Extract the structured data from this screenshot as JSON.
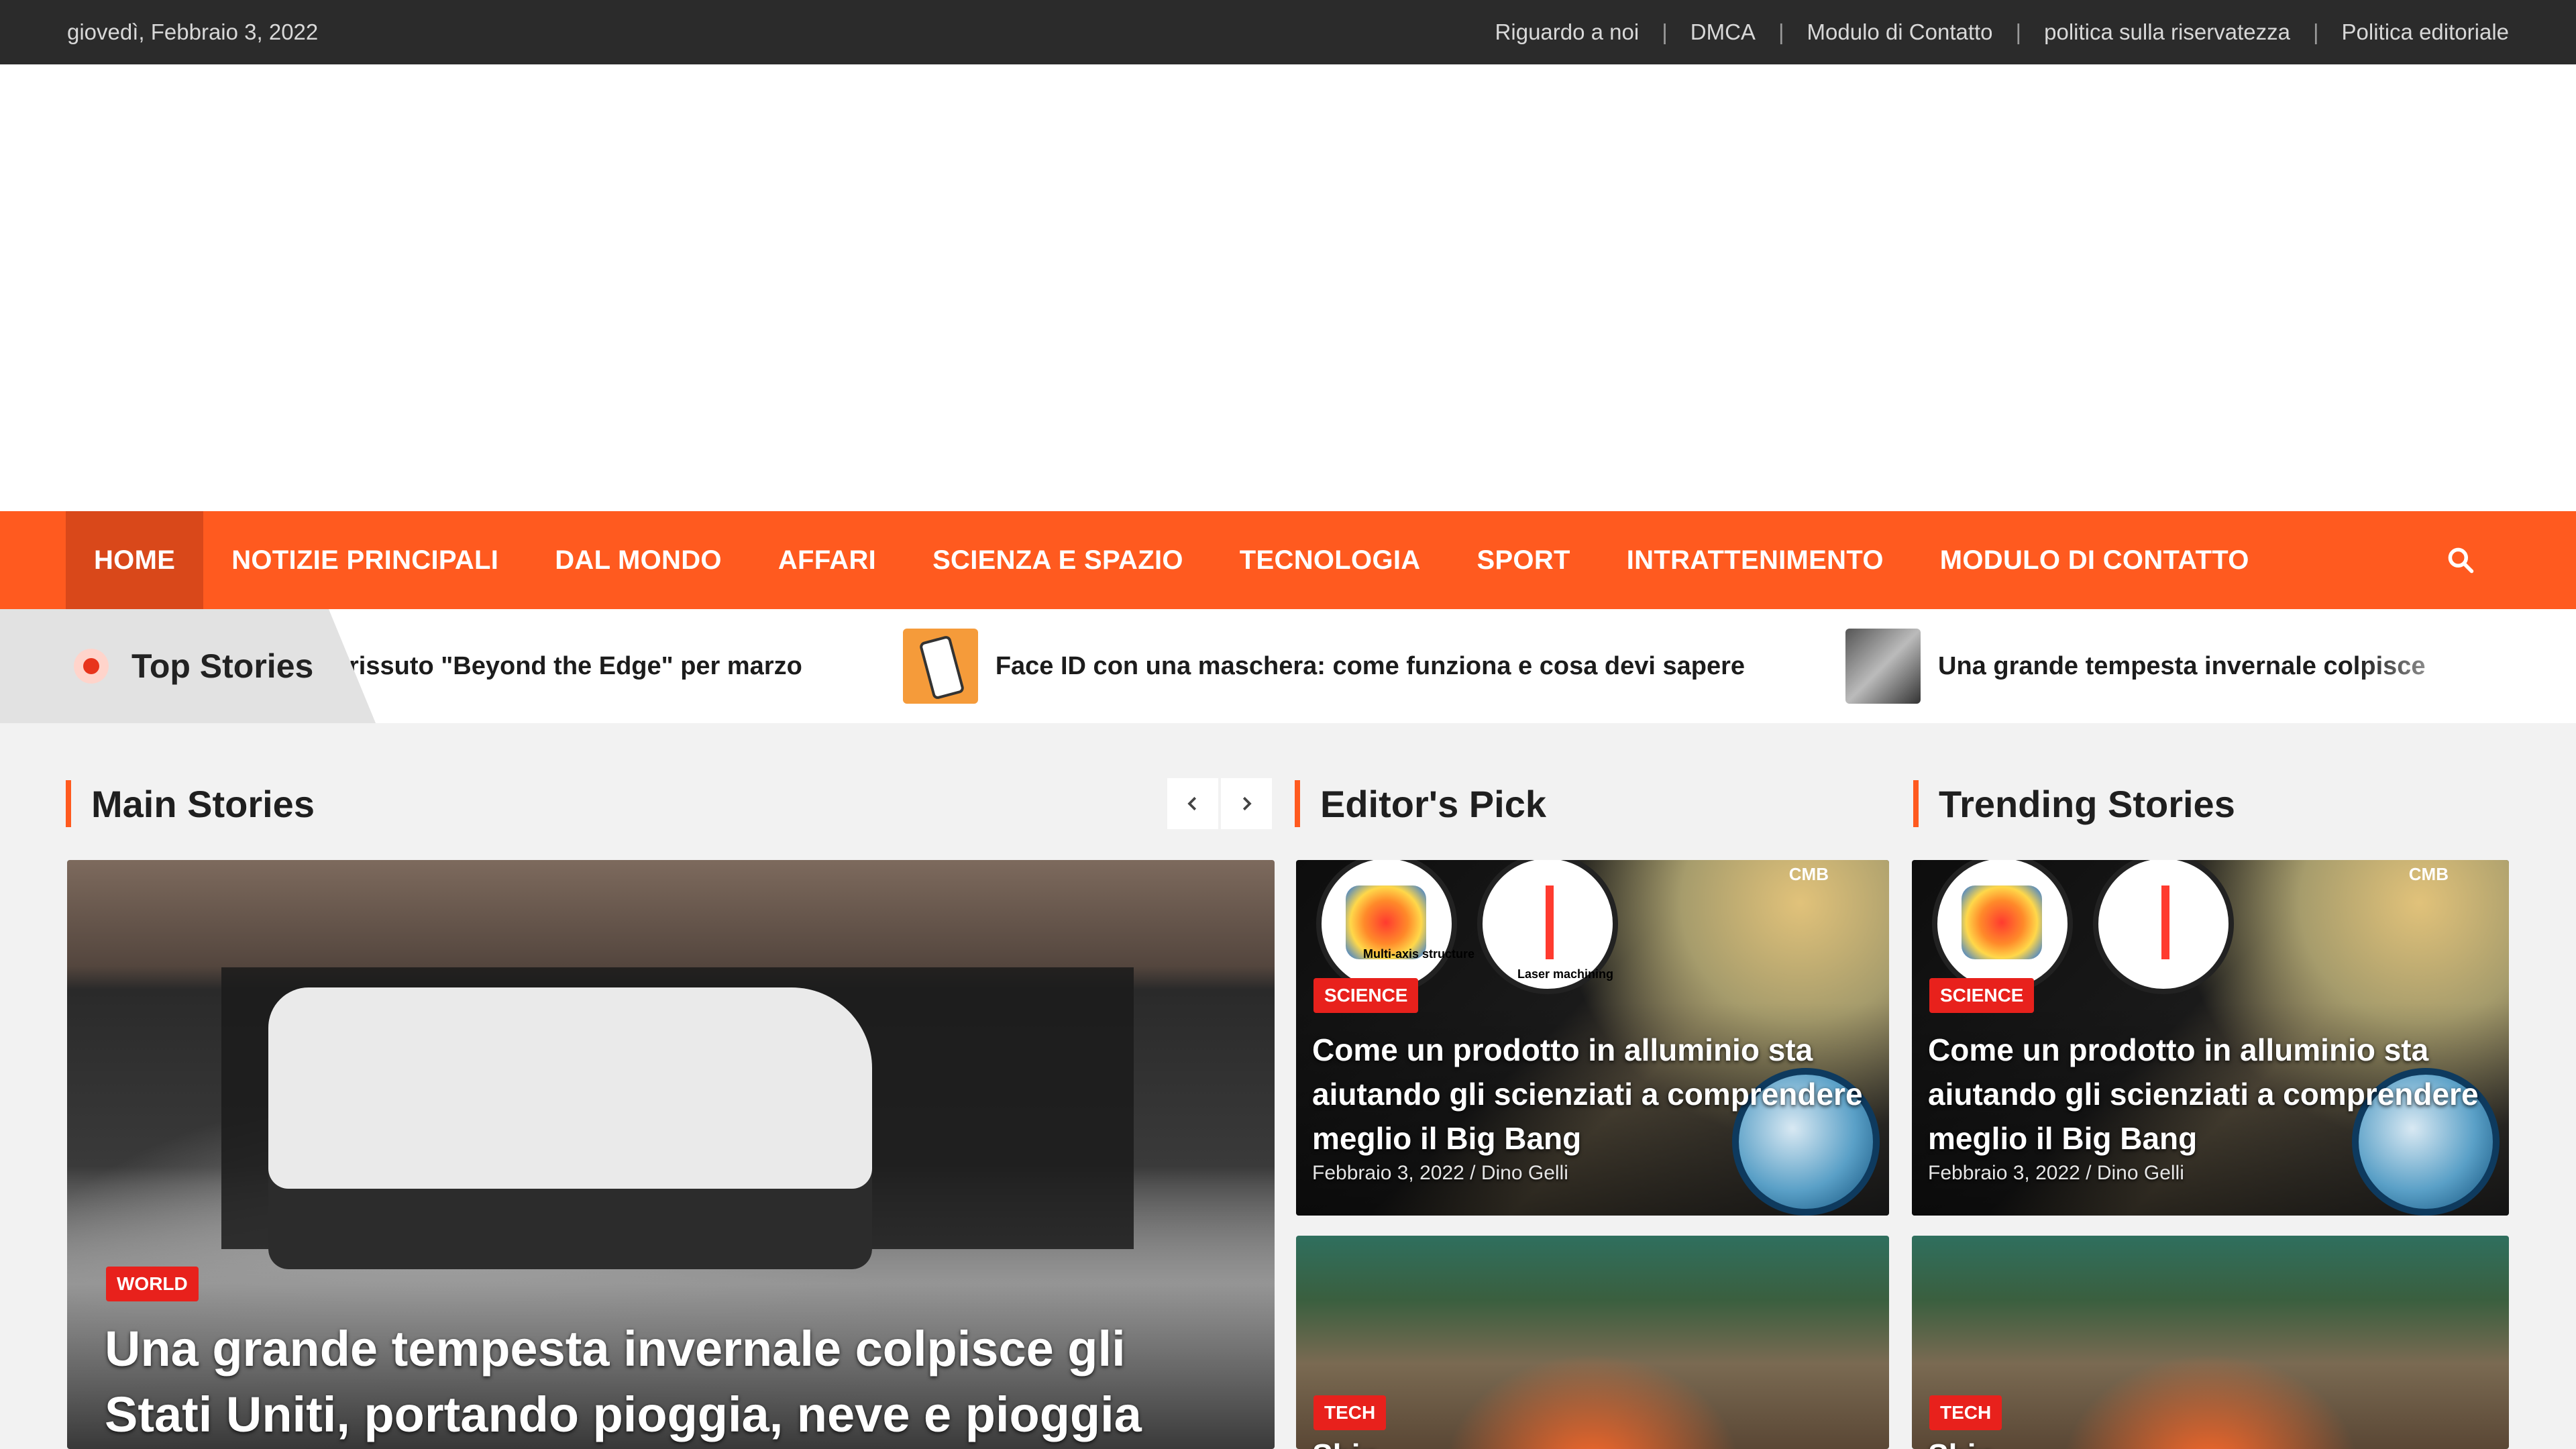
{
  "topbar": {
    "date": "giovedì, Febbraio 3, 2022",
    "links": [
      "Riguardo a noi",
      "DMCA",
      "Modulo di Contatto",
      "politica sulla riservatezza",
      "Politica editoriale"
    ]
  },
  "nav": {
    "items": [
      "HOME",
      "NOTIZIE PRINCIPALI",
      "DAL MONDO",
      "AFFARI",
      "SCIENZA E SPAZIO",
      "TECNOLOGIA",
      "SPORT",
      "INTRATTENIMENTO",
      "MODULO DI CONTATTO"
    ],
    "active": "HOME",
    "search_icon": "search-icon"
  },
  "ticker": {
    "label": "Top Stories",
    "items": [
      "rissuto \"Beyond the Edge\" per marzo",
      "Face ID con una maschera: come funziona e cosa devi sapere",
      "Una grande tempesta invernale colpisce"
    ]
  },
  "sections": {
    "main": "Main Stories",
    "editors": "Editor's Pick",
    "trending": "Trending Stories"
  },
  "main_story": {
    "badge": "WORLD",
    "title": "Una grande tempesta invernale colpisce gli Stati Uniti, portando pioggia, neve e pioggia"
  },
  "editors_pick": [
    {
      "badge": "SCIENCE",
      "title": "Come un prodotto in alluminio sta aiutando gli scienziati a comprendere meglio il Big Bang",
      "meta": "Febbraio 3, 2022 / Dino Gelli",
      "label1": "Multi-axis structure",
      "label2": "Laser machining",
      "cmb": "CMB"
    },
    {
      "badge": "TECH",
      "title": "Shin..."
    }
  ],
  "trending": [
    {
      "badge": "SCIENCE",
      "title": "Come un prodotto in alluminio sta aiutando gli scienziati a comprendere meglio il Big Bang",
      "meta": "Febbraio 3, 2022 / Dino Gelli",
      "cmb": "CMB"
    },
    {
      "badge": "TECH",
      "title": "Shin..."
    }
  ],
  "colors": {
    "accent": "#ff5a1f",
    "topbar": "#2b2b2b",
    "badge": "#e8211c"
  }
}
